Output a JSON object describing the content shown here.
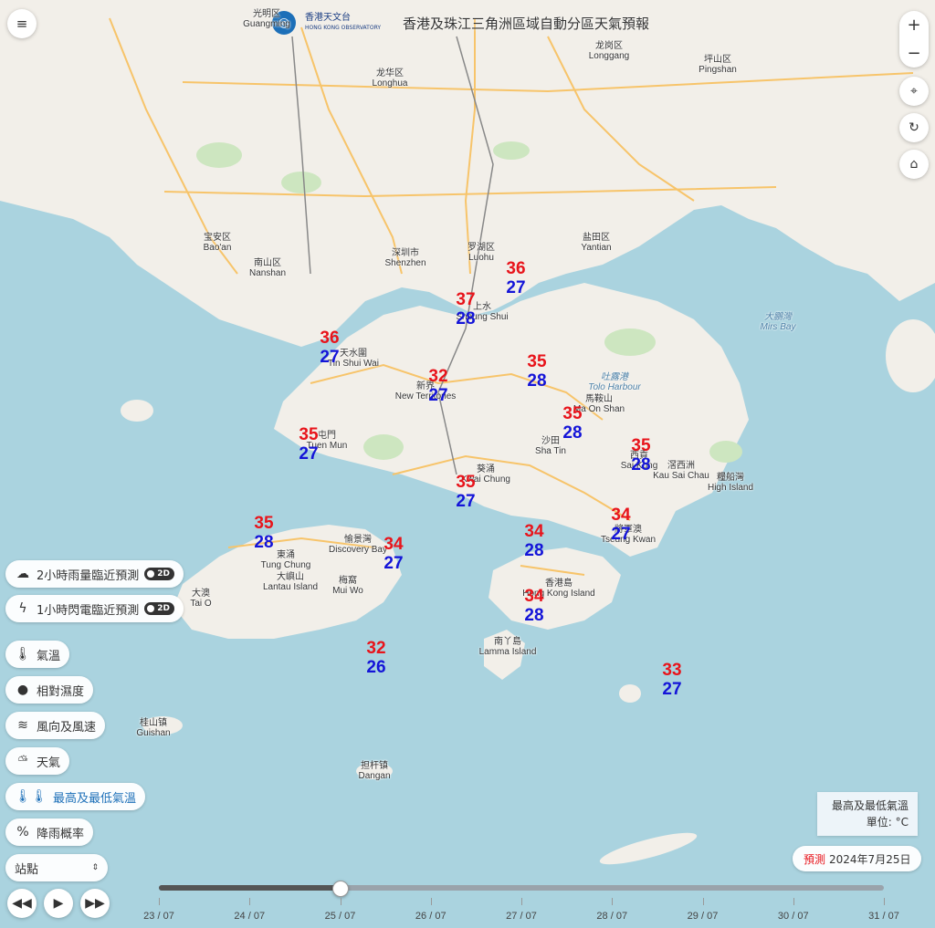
{
  "header": {
    "logo_zh": "香港天文台",
    "logo_en": "HONG KONG OBSERVATORY",
    "title": "香港及珠江三角洲區域自動分區天氣預報"
  },
  "map_controls": {
    "zoom_in": "+",
    "zoom_out": "−"
  },
  "icons": {
    "menu": "menu-icon",
    "locate": "crosshair-icon",
    "refresh": "refresh-icon",
    "home": "home-icon"
  },
  "layers": {
    "rain_nowcast": {
      "label": "2小時雨量臨近預測",
      "toggle": "2D"
    },
    "lightning_nowcast": {
      "label": "1小時閃電臨近預測",
      "toggle": "2D"
    },
    "items": [
      {
        "label": "氣溫"
      },
      {
        "label": "相對濕度"
      },
      {
        "label": "風向及風速"
      },
      {
        "label": "天氣"
      },
      {
        "label": "最高及最低氣溫"
      },
      {
        "label": "降雨概率"
      }
    ],
    "select_value": "站點"
  },
  "legend": {
    "line1": "最高及最低氣溫",
    "line2": "單位: °C"
  },
  "forecast": {
    "tag": "預測",
    "date": "2024年7月25日"
  },
  "timeline": {
    "ticks": [
      "23 / 07",
      "24 / 07",
      "25 / 07",
      "26 / 07",
      "27 / 07",
      "28 / 07",
      "29 / 07",
      "30 / 07",
      "31 / 07"
    ],
    "current_day": "25 / 07"
  },
  "places": [
    {
      "zh": "光明区",
      "en": "Guangming"
    },
    {
      "zh": "龙华区",
      "en": "Longhua"
    },
    {
      "zh": "龙岗区",
      "en": "Longgang"
    },
    {
      "zh": "坪山区",
      "en": "Pingshan"
    },
    {
      "zh": "宝安区",
      "en": "Bao'an"
    },
    {
      "zh": "南山区",
      "en": "Nanshan"
    },
    {
      "zh": "深圳市",
      "en": "Shenzhen"
    },
    {
      "zh": "罗湖区",
      "en": "Luohu"
    },
    {
      "zh": "盐田区",
      "en": "Yantian"
    },
    {
      "zh": "大鵬灣",
      "en": "Mirs Bay"
    },
    {
      "zh": "吐露港",
      "en": "Tolo Harbour"
    },
    {
      "zh": "馬鞍山",
      "en": "Ma On Shan"
    },
    {
      "zh": "沙田",
      "en": "Sha Tin"
    },
    {
      "zh": "西貢",
      "en": "Sai Kung"
    },
    {
      "zh": "滘西洲",
      "en": "Kau Sai Chau"
    },
    {
      "zh": "糧船灣",
      "en": "High Island"
    },
    {
      "zh": "葵涌",
      "en": "Kwai Chung"
    },
    {
      "zh": "東涌",
      "en": "Tung Chung"
    },
    {
      "zh": "愉景灣",
      "en": "Discovery Bay"
    },
    {
      "zh": "大嶼山",
      "en": "Lantau Island"
    },
    {
      "zh": "梅窩",
      "en": "Mui Wo"
    },
    {
      "zh": "大澳",
      "en": "Tai O"
    },
    {
      "zh": "香港島",
      "en": "Hong Kong Island"
    },
    {
      "zh": "南丫島",
      "en": "Lamma Island"
    },
    {
      "zh": "桂山镇",
      "en": "Guishan"
    },
    {
      "zh": "担杆镇",
      "en": "Dangan"
    },
    {
      "zh": "新界",
      "en": "New Territories"
    },
    {
      "zh": "天水圍",
      "en": "Tin Shui Wai"
    },
    {
      "zh": "屯門",
      "en": "Tuen Mun"
    },
    {
      "zh": "上水",
      "en": "Sheung Shui"
    },
    {
      "zh": "將軍澳",
      "en": "Tseung Kwan"
    }
  ],
  "stations": [
    {
      "hi": "36",
      "lo": "27"
    },
    {
      "hi": "37",
      "lo": "28"
    },
    {
      "hi": "36",
      "lo": "27"
    },
    {
      "hi": "32",
      "lo": "27"
    },
    {
      "hi": "35",
      "lo": "28"
    },
    {
      "hi": "35",
      "lo": "28"
    },
    {
      "hi": "35",
      "lo": "27"
    },
    {
      "hi": "35",
      "lo": "28"
    },
    {
      "hi": "35",
      "lo": "27"
    },
    {
      "hi": "34",
      "lo": "27"
    },
    {
      "hi": "34",
      "lo": "28"
    },
    {
      "hi": "35",
      "lo": "28"
    },
    {
      "hi": "34",
      "lo": "27"
    },
    {
      "hi": "34",
      "lo": "28"
    },
    {
      "hi": "32",
      "lo": "26"
    },
    {
      "hi": "33",
      "lo": "27"
    }
  ],
  "colors": {
    "max_temp": "#e8141b",
    "min_temp": "#1414d8",
    "sea": "#aad3df",
    "land": "#f2efe9"
  }
}
